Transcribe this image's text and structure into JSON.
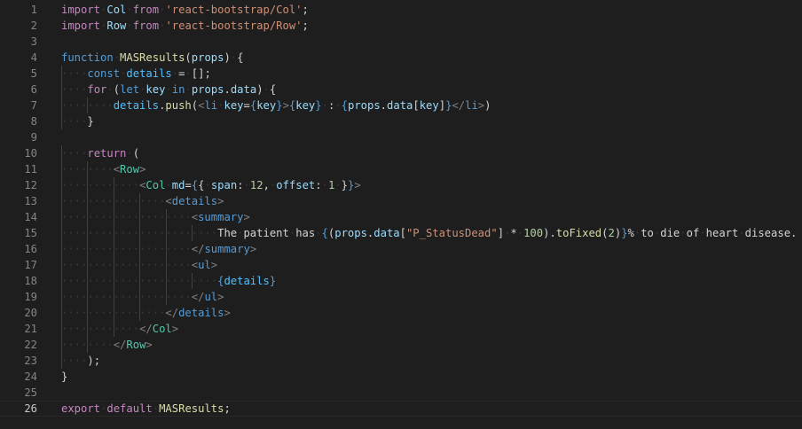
{
  "editor": {
    "active_line": 26,
    "lines": [
      [
        [
          "k",
          "import"
        ],
        [
          "d",
          " "
        ],
        [
          "v",
          "Col"
        ],
        [
          "d",
          " "
        ],
        [
          "k",
          "from"
        ],
        [
          "d",
          " "
        ],
        [
          "s",
          "'react-bootstrap/Col'"
        ],
        [
          "d",
          ";"
        ]
      ],
      [
        [
          "k",
          "import"
        ],
        [
          "d",
          " "
        ],
        [
          "v",
          "Row"
        ],
        [
          "d",
          " "
        ],
        [
          "k",
          "from"
        ],
        [
          "d",
          " "
        ],
        [
          "s",
          "'react-bootstrap/Row'"
        ],
        [
          "d",
          ";"
        ]
      ],
      [],
      [
        [
          "b",
          "function"
        ],
        [
          "d",
          " "
        ],
        [
          "f",
          "MASResults"
        ],
        [
          "d",
          "("
        ],
        [
          "v",
          "props"
        ],
        [
          "d",
          ") {"
        ]
      ],
      [
        [
          "d",
          "    "
        ],
        [
          "b",
          "const"
        ],
        [
          "d",
          " "
        ],
        [
          "c",
          "details"
        ],
        [
          "d",
          " = [];"
        ]
      ],
      [
        [
          "d",
          "    "
        ],
        [
          "k",
          "for"
        ],
        [
          "d",
          " ("
        ],
        [
          "b",
          "let"
        ],
        [
          "d",
          " "
        ],
        [
          "v",
          "key"
        ],
        [
          "d",
          " "
        ],
        [
          "b",
          "in"
        ],
        [
          "d",
          " "
        ],
        [
          "v",
          "props"
        ],
        [
          "d",
          "."
        ],
        [
          "v",
          "data"
        ],
        [
          "d",
          ") {"
        ]
      ],
      [
        [
          "d",
          "        "
        ],
        [
          "c",
          "details"
        ],
        [
          "d",
          "."
        ],
        [
          "f",
          "push"
        ],
        [
          "d",
          "("
        ],
        [
          "p",
          "<"
        ],
        [
          "h",
          "li"
        ],
        [
          "d",
          " "
        ],
        [
          "v",
          "key"
        ],
        [
          "d",
          "="
        ],
        [
          "b",
          "{"
        ],
        [
          "v",
          "key"
        ],
        [
          "b",
          "}"
        ],
        [
          "p",
          ">"
        ],
        [
          "b",
          "{"
        ],
        [
          "v",
          "key"
        ],
        [
          "b",
          "}"
        ],
        [
          "d",
          " : "
        ],
        [
          "b",
          "{"
        ],
        [
          "v",
          "props"
        ],
        [
          "d",
          "."
        ],
        [
          "v",
          "data"
        ],
        [
          "d",
          "["
        ],
        [
          "v",
          "key"
        ],
        [
          "d",
          "]"
        ],
        [
          "b",
          "}"
        ],
        [
          "p",
          "</"
        ],
        [
          "h",
          "li"
        ],
        [
          "p",
          ">"
        ],
        [
          "d",
          ")"
        ]
      ],
      [
        [
          "d",
          "    }"
        ]
      ],
      [],
      [
        [
          "d",
          "    "
        ],
        [
          "k",
          "return"
        ],
        [
          "d",
          " ("
        ]
      ],
      [
        [
          "d",
          "        "
        ],
        [
          "p",
          "<"
        ],
        [
          "t",
          "Row"
        ],
        [
          "p",
          ">"
        ]
      ],
      [
        [
          "d",
          "            "
        ],
        [
          "p",
          "<"
        ],
        [
          "t",
          "Col"
        ],
        [
          "d",
          " "
        ],
        [
          "v",
          "md"
        ],
        [
          "d",
          "="
        ],
        [
          "b",
          "{"
        ],
        [
          "d",
          "{ "
        ],
        [
          "v",
          "span"
        ],
        [
          "d",
          ": "
        ],
        [
          "n",
          "12"
        ],
        [
          "d",
          ", "
        ],
        [
          "v",
          "offset"
        ],
        [
          "d",
          ": "
        ],
        [
          "n",
          "1"
        ],
        [
          "d",
          " }"
        ],
        [
          "b",
          "}"
        ],
        [
          "p",
          ">"
        ]
      ],
      [
        [
          "d",
          "                "
        ],
        [
          "p",
          "<"
        ],
        [
          "h",
          "details"
        ],
        [
          "p",
          ">"
        ]
      ],
      [
        [
          "d",
          "                    "
        ],
        [
          "p",
          "<"
        ],
        [
          "h",
          "summary"
        ],
        [
          "p",
          ">"
        ]
      ],
      [
        [
          "d",
          "                        The patient has "
        ],
        [
          "b",
          "{"
        ],
        [
          "d",
          "("
        ],
        [
          "v",
          "props"
        ],
        [
          "d",
          "."
        ],
        [
          "v",
          "data"
        ],
        [
          "d",
          "["
        ],
        [
          "s",
          "\"P_StatusDead\""
        ],
        [
          "d",
          "] * "
        ],
        [
          "n",
          "100"
        ],
        [
          "d",
          ")."
        ],
        [
          "f",
          "toFixed"
        ],
        [
          "d",
          "("
        ],
        [
          "n",
          "2"
        ],
        [
          "d",
          ")"
        ],
        [
          "b",
          "}"
        ],
        [
          "d",
          "% to die of heart disease."
        ]
      ],
      [
        [
          "d",
          "                    "
        ],
        [
          "p",
          "</"
        ],
        [
          "h",
          "summary"
        ],
        [
          "p",
          ">"
        ]
      ],
      [
        [
          "d",
          "                    "
        ],
        [
          "p",
          "<"
        ],
        [
          "h",
          "ul"
        ],
        [
          "p",
          ">"
        ]
      ],
      [
        [
          "d",
          "                        "
        ],
        [
          "b",
          "{"
        ],
        [
          "c",
          "details"
        ],
        [
          "b",
          "}"
        ]
      ],
      [
        [
          "d",
          "                    "
        ],
        [
          "p",
          "</"
        ],
        [
          "h",
          "ul"
        ],
        [
          "p",
          ">"
        ]
      ],
      [
        [
          "d",
          "                "
        ],
        [
          "p",
          "</"
        ],
        [
          "h",
          "details"
        ],
        [
          "p",
          ">"
        ]
      ],
      [
        [
          "d",
          "            "
        ],
        [
          "p",
          "</"
        ],
        [
          "t",
          "Col"
        ],
        [
          "p",
          ">"
        ]
      ],
      [
        [
          "d",
          "        "
        ],
        [
          "p",
          "</"
        ],
        [
          "t",
          "Row"
        ],
        [
          "p",
          ">"
        ]
      ],
      [
        [
          "d",
          "    );"
        ]
      ],
      [
        [
          "d",
          "}"
        ]
      ],
      [],
      [
        [
          "k",
          "export"
        ],
        [
          "d",
          " "
        ],
        [
          "k",
          "default"
        ],
        [
          "d",
          " "
        ],
        [
          "f",
          "MASResults"
        ],
        [
          "d",
          ";"
        ]
      ]
    ]
  }
}
